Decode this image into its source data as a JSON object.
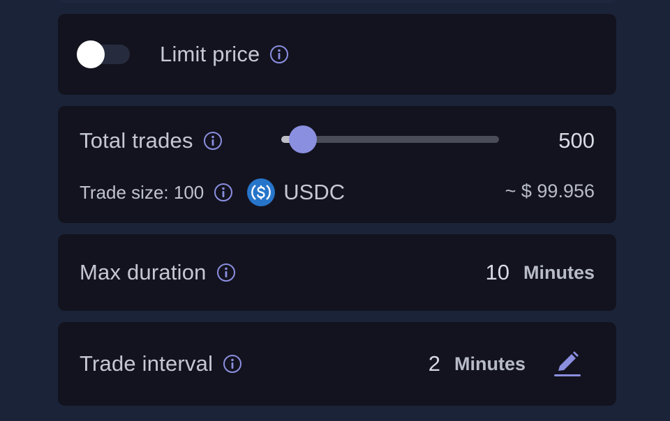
{
  "limit_price": {
    "label": "Limit price",
    "enabled": false
  },
  "total_trades": {
    "label": "Total trades",
    "value": "500",
    "slider_fraction": 0.1
  },
  "trade_size": {
    "label": "Trade size: 100",
    "token_icon": "usdc-icon",
    "token": "USDC",
    "usd_value": "~ $ 99.956"
  },
  "max_duration": {
    "label": "Max duration",
    "value": "10",
    "unit": "Minutes"
  },
  "trade_interval": {
    "label": "Trade interval",
    "value": "2",
    "unit": "Minutes",
    "edit_icon": "pencil-icon"
  },
  "colors": {
    "background": "#1b2338",
    "card": "#13131f",
    "accent": "#8b8fe0",
    "usdc": "#2775ca"
  }
}
